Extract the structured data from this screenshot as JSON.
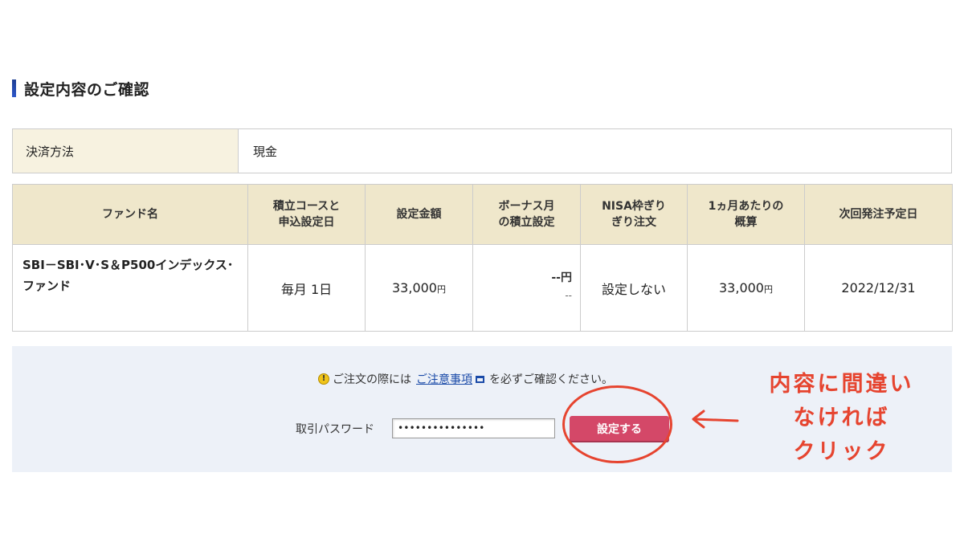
{
  "section": {
    "title": "設定内容のご確認"
  },
  "payment": {
    "label": "決済方法",
    "value": "現金"
  },
  "fund_table": {
    "headers": {
      "fund_name": "ファンド名",
      "course_line1": "積立コースと",
      "course_line2": "申込設定日",
      "amount": "設定金額",
      "bonus_line1": "ボーナス月",
      "bonus_line2": "の積立設定",
      "nisa_line1": "NISA枠ぎり",
      "nisa_line2": "ぎり注文",
      "monthly_line1": "1ヵ月あたりの",
      "monthly_line2": "概算",
      "next_date": "次回発注予定日"
    },
    "row": {
      "fund_name": "SBI－SBI･V･S＆P500インデックス･ファンド",
      "course": "毎月 1日",
      "amount": "33,000",
      "amount_unit": "円",
      "bonus_value": "--円",
      "bonus_sub": "--",
      "nisa": "設定しない",
      "monthly": "33,000",
      "monthly_unit": "円",
      "next_date": "2022/12/31"
    }
  },
  "confirm": {
    "notice_prefix": "ご注文の際には",
    "notice_link": "ご注意事項",
    "notice_suffix": "を必ずご確認ください。",
    "password_label": "取引パスワード",
    "password_value": "•••••••••••••••",
    "submit_label": "設定する"
  },
  "annotation": {
    "line1": "内容に間違い",
    "line2": "なければ",
    "line3": "クリック",
    "color": "#e6442f"
  },
  "colors": {
    "title_bar": "#1e3e94",
    "header_bg": "#efe7cb",
    "panel_bg": "#edf1f8",
    "submit_bg": "#d44868",
    "link": "#1a4aa8"
  }
}
